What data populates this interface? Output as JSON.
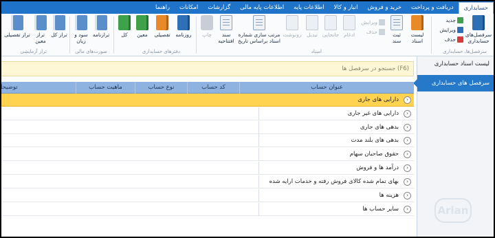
{
  "tabs": [
    {
      "label": "حسابداری",
      "active": true
    },
    {
      "label": "دریافت و پرداخت",
      "active": false
    },
    {
      "label": "خرید و فروش",
      "active": false
    },
    {
      "label": "انبار و کالا",
      "active": false
    },
    {
      "label": "اطلاعات پایه",
      "active": false
    },
    {
      "label": "اطلاعات پایه مالی",
      "active": false
    },
    {
      "label": "گزارشات",
      "active": false
    },
    {
      "label": "امکانات",
      "active": false
    },
    {
      "label": "راهنما",
      "active": false
    }
  ],
  "ribbon": {
    "accounts_title": "سرفصل‌های حسابداری",
    "new": "جدید",
    "edit": "ویرایش",
    "delete": "حذف",
    "group_accounts": "سرفصل‌ها، حسابداری",
    "voucher_list": "لیست اسناد",
    "voucher": "ثبت سند",
    "voucher_edit": "ویرایش",
    "voucher_delete": "حذف",
    "merge": "ادغام",
    "move": "جابجایی",
    "convert": "تبدیل",
    "copy": "رونوشت",
    "sort": "مرتب سازی شماره اسناد براساس تاریخ",
    "opening": "سند افتتاحیه",
    "print": "چاپ",
    "group_voucher": "اسناد",
    "journal": "روزنامه",
    "detailed": "تفصیلی",
    "specific": "معین",
    "general": "کل",
    "group_books": "دفترهای حسابداری",
    "balance_sheet": "ترازنامه",
    "profit_loss": "سود و زیان",
    "group_financial": "صورت‌های مالی",
    "trial_general": "تراز کل",
    "trial_specific": "تراز معین",
    "trial_detailed": "تراز تفصیلی",
    "group_trial": "تراز آزمایشی"
  },
  "right_panel": {
    "items": [
      "لیست اسناد حسابداری",
      "سرفصل های حسابداری"
    ]
  },
  "search": {
    "placeholder": "(F6) جستجو در سرفصل ها"
  },
  "grid": {
    "headers": [
      "عنوان حساب",
      "کد حساب",
      "نوع حساب",
      "ماهیت حساب",
      "توضیحات"
    ],
    "rows": [
      "دارایی های جاری",
      "دارایی های غیر جاری",
      "بدهی های جاری",
      "بدهی های بلند مدت",
      "حقوق صاحبان سهام",
      "درآمد ها و فروش",
      "بهای تمام شده کالای فروش رفته و خدمات ارایه شده",
      "هزینه ها",
      "سایر حساب ها"
    ]
  },
  "logo_text": "Arian"
}
